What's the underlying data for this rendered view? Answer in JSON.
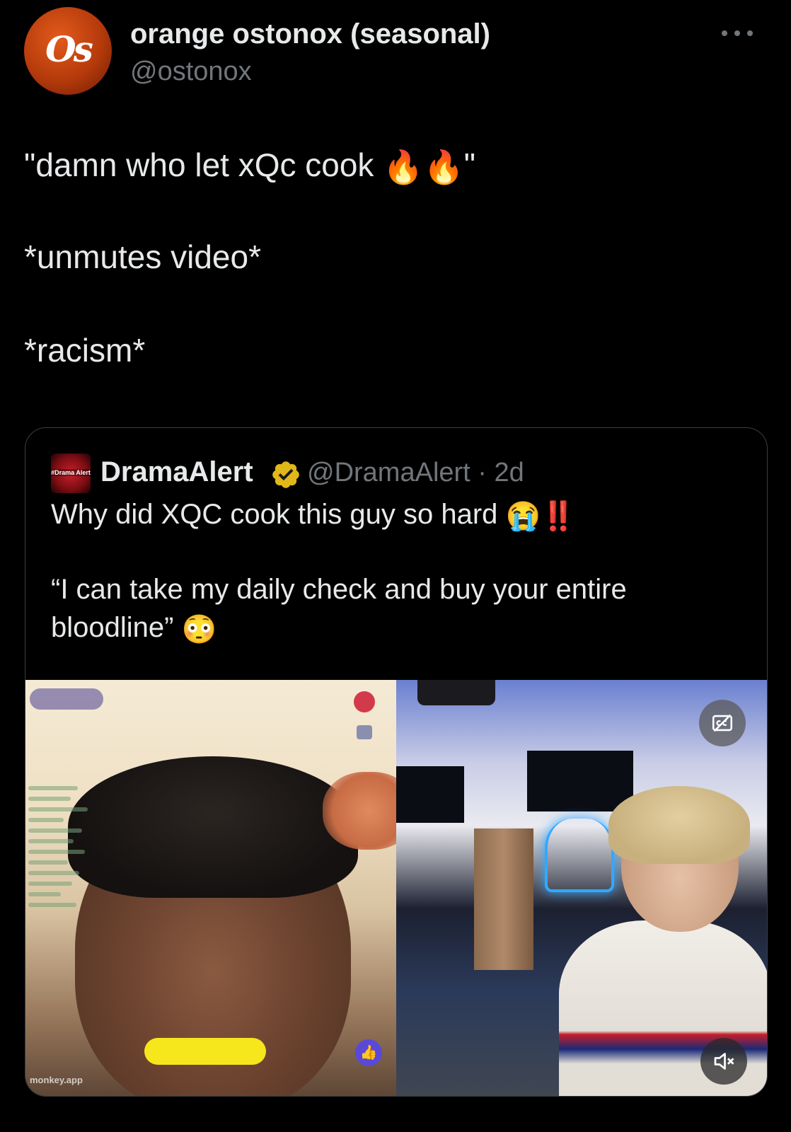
{
  "author": {
    "display_name": "orange ostonox (seasonal)",
    "handle": "@ostonox",
    "avatar_initials": "Os"
  },
  "tweet": {
    "line1_text": "\"damn who let xQc cook ",
    "line1_emoji": "🔥🔥",
    "line1_close": "\"",
    "line2": "*unmutes video*",
    "line3": "*racism*"
  },
  "quote": {
    "display_name": "DramaAlert",
    "handle_and_time": "@DramaAlert · 2d",
    "avatar_label": "#Drama Alert",
    "line1_text": "Why did XQC cook this guy so hard ",
    "line1_emoji": "😭‼️",
    "line2": "“I can take my daily check and buy your entire",
    "line3_text": "bloodline” ",
    "line3_emoji": "😳",
    "verified_color": "#e2b719",
    "media": {
      "left_watermark": "monkey.app"
    }
  },
  "icons": {
    "more": "more-horizontal-icon",
    "verified": "verified-badge-icon",
    "captions": "captions-icon",
    "mute": "speaker-muted-icon"
  },
  "colors": {
    "background": "#000000",
    "text": "#e7e9ea",
    "muted_text": "#71767b",
    "card_border": "#3a3d41"
  }
}
